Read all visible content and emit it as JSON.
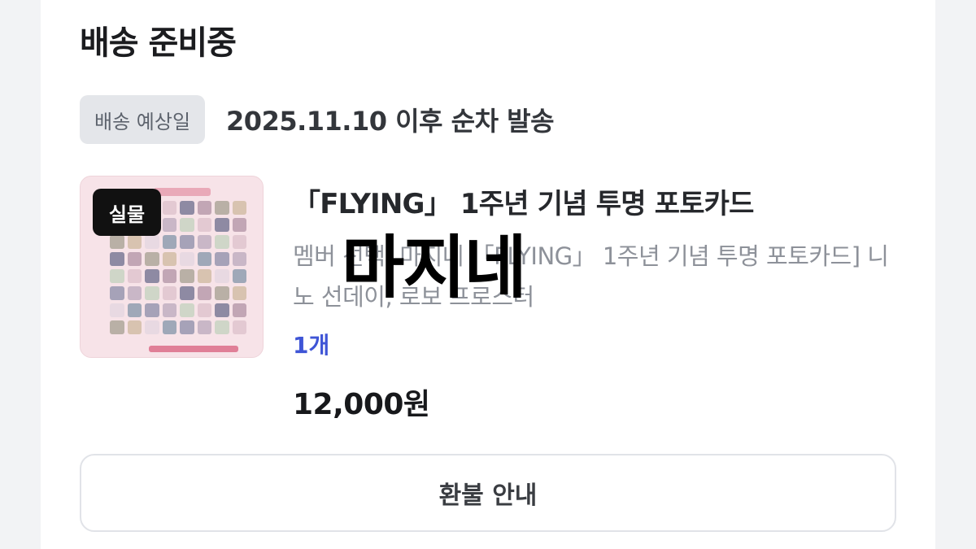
{
  "section": {
    "title": "배송 준비중"
  },
  "shipping": {
    "badge_label": "배송 예상일",
    "date_text": "2025.11.10 이후 순차 발송"
  },
  "product": {
    "thumb_badge": "실물",
    "title": "「FLYING」 1주년 기념 투명 포토카드",
    "option": "멤버 선택: 마지네 「FLYING」 1주년 기념 투명 포토카드] 니노 선데이, 로보 프로스터",
    "quantity": "1개",
    "price": "12,000원",
    "thumbnail_icon": "photocard-sheet-image"
  },
  "overlay": {
    "watermark_text": "마지네"
  },
  "actions": {
    "refund_label": "환불 안내"
  },
  "colors": {
    "background": "#f2f3f5",
    "badge_bg": "#e4e6ea",
    "quantity_accent": "#3f55d6",
    "thumb_bg": "#f7e3e8"
  }
}
